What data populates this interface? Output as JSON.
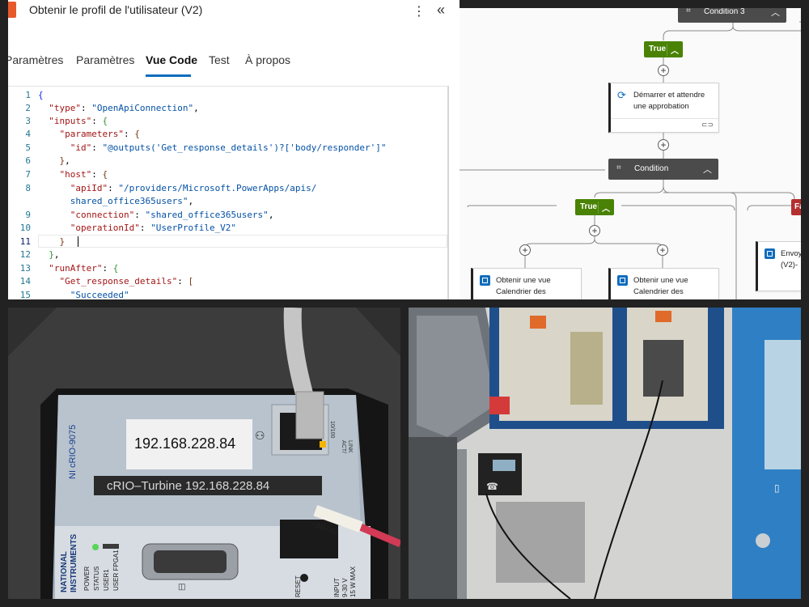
{
  "code_panel": {
    "title": "Obtenir le profil de l'utilisateur (V2)",
    "tabs": [
      {
        "label": "Paramètres"
      },
      {
        "label": "Paramètres"
      },
      {
        "label": "Vue Code"
      },
      {
        "label": "Test"
      },
      {
        "label": "À propos"
      }
    ],
    "active_tab": "Vue Code",
    "lines": [
      {
        "n": "1"
      },
      {
        "n": "2"
      },
      {
        "n": "3"
      },
      {
        "n": "4"
      },
      {
        "n": "5"
      },
      {
        "n": "6"
      },
      {
        "n": "7"
      },
      {
        "n": "8"
      },
      {
        "n": "9"
      },
      {
        "n": "10"
      },
      {
        "n": "11"
      },
      {
        "n": "12"
      },
      {
        "n": "13"
      },
      {
        "n": "14"
      },
      {
        "n": "15"
      }
    ],
    "tokens": {
      "type_key": "\"type\"",
      "type_val": "\"OpenApiConnection\"",
      "inputs_key": "\"inputs\"",
      "parameters_key": "\"parameters\"",
      "id_key": "\"id\"",
      "id_val": "\"@outputs('Get_response_details')?['body/responder']\"",
      "host_key": "\"host\"",
      "apiid_key": "\"apiId\"",
      "apiid_val_1": "\"/providers/Microsoft.PowerApps/apis/",
      "apiid_val_2": "shared_office365users\"",
      "connection_key": "\"connection\"",
      "connection_val": "\"shared_office365users\"",
      "operationid_key": "\"operationId\"",
      "operationid_val": "\"UserProfile_V2\"",
      "runafter_key": "\"runAfter\"",
      "grd_key": "\"Get_response_details\"",
      "succeeded_val": "\"Succeeded\""
    }
  },
  "flow_panel": {
    "condition_top": "Condition 3",
    "condition_mid": "Condition",
    "true_label": "True",
    "false_label": "Fa",
    "approval_card": "Démarrer et attendre une approbation",
    "calendar_card_1": "Obtenir une vue Calendrier des",
    "calendar_card_2": "Obtenir une vue Calendrier des",
    "send_card": "Envoy (V2)-",
    "accent_true": "#498205",
    "accent_false": "#b52f2f"
  },
  "photo_crio": {
    "ip_label": "192.168.228.84",
    "model_label": "NI cRIO-9075",
    "name_label": "cRIO–Turbine 192.168.228.84",
    "brand_line_1": "NATIONAL",
    "brand_line_2": "INSTRUMENTS",
    "leds": [
      {
        "label": "POWER"
      },
      {
        "label": "STATUS"
      },
      {
        "label": "USER1"
      },
      {
        "label": "USER FPGA1"
      }
    ],
    "port_label_1": "ACT/",
    "port_label_2": "LINK",
    "port_speed": "10/100",
    "wire_tag": "+24V-02",
    "reset_label": "RESET",
    "input_label_1": "INPUT",
    "input_label_2": "9-30 V",
    "input_label_3": "15 W MAX",
    "serial_icon": "serial-port-icon",
    "network_icon": "network-icon"
  },
  "photo_room": {
    "phone_icon": "desk-phone-icon",
    "door_icon": "door-icon"
  }
}
